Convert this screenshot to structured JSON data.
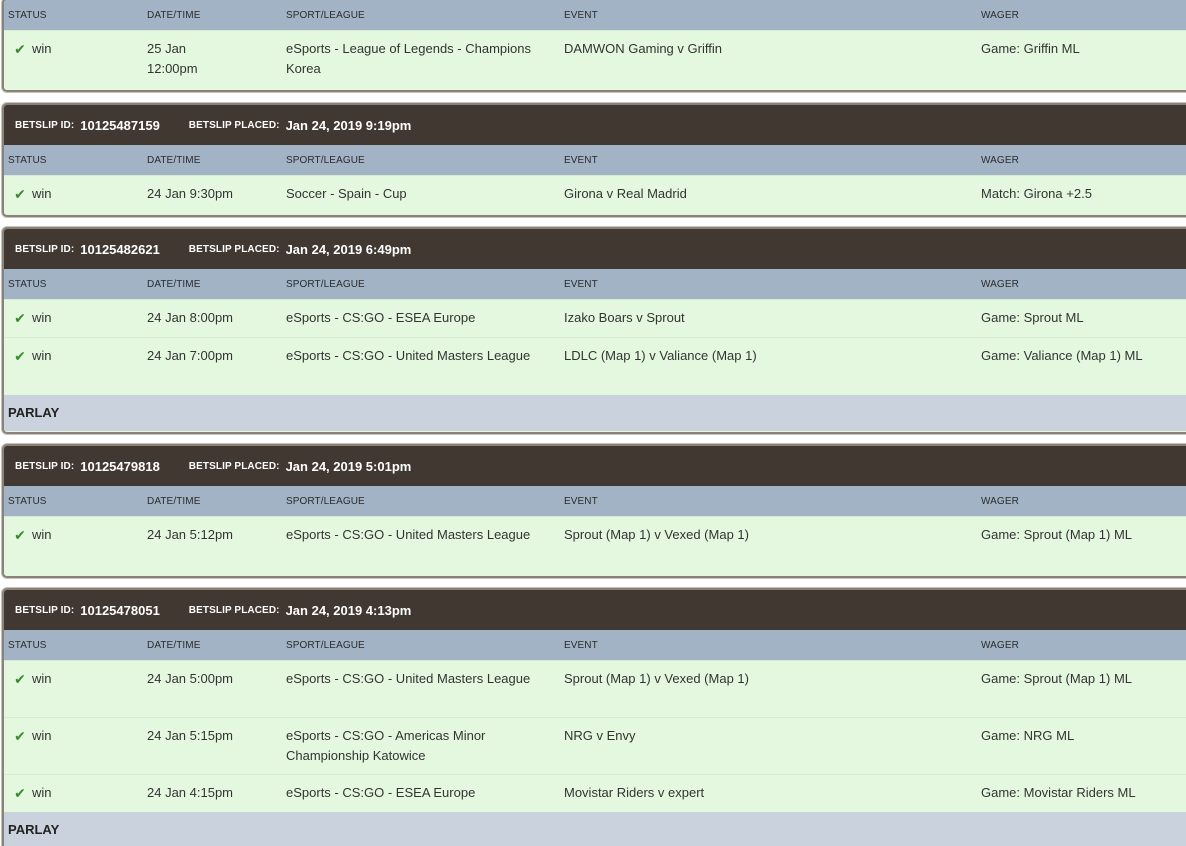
{
  "columns": {
    "status": "STATUS",
    "date": "DATE/TIME",
    "sport": "SPORT/LEAGUE",
    "event": "EVENT",
    "wager": "WAGER"
  },
  "labels": {
    "betslip_id": "BETSLIP ID:",
    "betslip_placed": "BETSLIP PLACED:",
    "parlay": "PARLAY"
  },
  "icons": {
    "status_win": "check-icon"
  },
  "colors": {
    "header_bg": "#403831",
    "column_bg": "#a2b3c6",
    "row_bg": "#e4f8e0",
    "parlay_bg": "#cad2dd",
    "check": "#3a8a2e"
  },
  "slips": [
    {
      "bets": [
        {
          "status": "win",
          "date": "25 Jan\n12:00pm",
          "sport": "eSports - League of Legends - Champions Korea",
          "event": "DAMWON Gaming v Griffin",
          "wager": "Game: Griffin ML"
        }
      ]
    },
    {
      "id": "10125487159",
      "placed": "Jan 24, 2019 9:19pm",
      "bets": [
        {
          "status": "win",
          "date": "24 Jan 9:30pm",
          "sport": "Soccer - Spain - Cup",
          "event": "Girona v Real Madrid",
          "wager": "Match: Girona +2.5"
        }
      ]
    },
    {
      "id": "10125482621",
      "placed": "Jan 24, 2019 6:49pm",
      "parlay": true,
      "bets": [
        {
          "status": "win",
          "date": "24 Jan 8:00pm",
          "sport": "eSports - CS:GO - ESEA Europe",
          "event": "Izako Boars v Sprout",
          "wager": "Game: Sprout ML"
        },
        {
          "status": "win",
          "date": "24 Jan 7:00pm",
          "sport": "eSports - CS:GO - United Masters League",
          "event": "LDLC (Map 1) v Valiance (Map 1)",
          "wager": "Game: Valiance (Map 1) ML"
        }
      ]
    },
    {
      "id": "10125479818",
      "placed": "Jan 24, 2019 5:01pm",
      "bets": [
        {
          "status": "win",
          "date": "24 Jan 5:12pm",
          "sport": "eSports - CS:GO - United Masters League",
          "event": "Sprout (Map 1) v Vexed (Map 1)",
          "wager": "Game: Sprout (Map 1) ML"
        }
      ]
    },
    {
      "id": "10125478051",
      "placed": "Jan 24, 2019 4:13pm",
      "parlay": true,
      "bets": [
        {
          "status": "win",
          "date": "24 Jan 5:00pm",
          "sport": "eSports - CS:GO - United Masters League",
          "event": "Sprout (Map 1) v Vexed (Map 1)",
          "wager": "Game: Sprout (Map 1) ML"
        },
        {
          "status": "win",
          "date": "24 Jan 5:15pm",
          "sport": "eSports - CS:GO - Americas Minor Championship Katowice",
          "event": "NRG v Envy",
          "wager": "Game: NRG ML"
        },
        {
          "status": "win",
          "date": "24 Jan 4:15pm",
          "sport": "eSports - CS:GO - ESEA Europe",
          "event": "Movistar Riders v expert",
          "wager": "Game: Movistar Riders ML"
        }
      ]
    }
  ]
}
